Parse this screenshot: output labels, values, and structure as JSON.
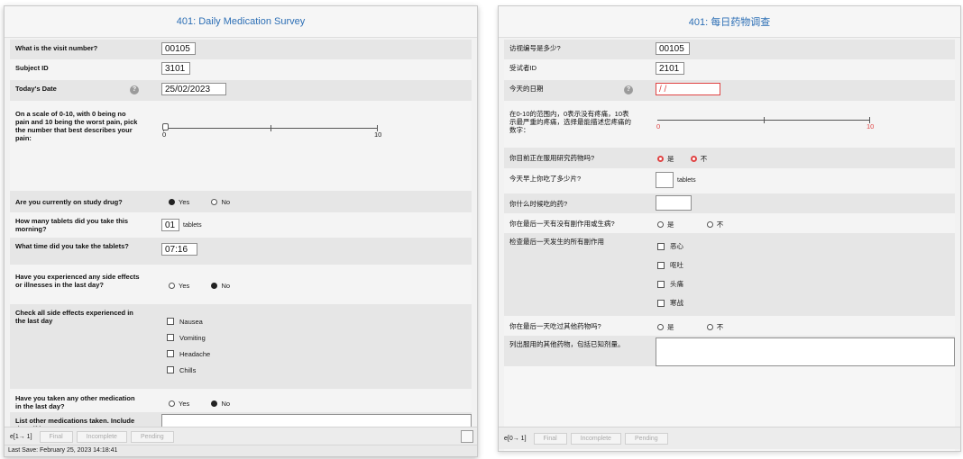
{
  "left": {
    "title": "401: Daily Medication Survey",
    "visit_q": "What is the visit number?",
    "visit_val": "00105",
    "subject_q": "Subject ID",
    "subject_val": "3101",
    "date_q": "Today's Date",
    "date_val": "25/02/2023",
    "help_glyph": "?",
    "pain_q": "On a scale of 0-10, with 0 being no pain and 10 being the worst pain, pick the number that best describes your pain:",
    "pain_min": "0",
    "pain_max": "10",
    "pain_value": 0,
    "drug_q": "Are you currently on study drug?",
    "drug_yes": "Yes",
    "drug_no": "No",
    "tablets_q": "How many tablets did you take this morning?",
    "tablets_val": "01",
    "tablets_unit": "tablets",
    "time_q": "What time did you take the tablets?",
    "time_val": "07:16",
    "side_q": "Have you experienced any side effects or illnesses in the last day?",
    "side_yes": "Yes",
    "side_no": "No",
    "check_q": "Check all side effects experienced in the last day",
    "effects": [
      "Nausea",
      "Vomiting",
      "Headache",
      "Chills"
    ],
    "other_q": "Have you taken any other medication in the last day?",
    "other_yes": "Yes",
    "other_no": "No",
    "list_q": "List other medications taken. Include dose if known.",
    "footer": {
      "tab": "e[1→ 1]",
      "final": "Final",
      "incomplete": "Incomplete",
      "pending": "Pending"
    },
    "status": "Last Save: February 25, 2023 14:18:41"
  },
  "right": {
    "title": "401: 每日药物调查",
    "visit_q": "访视编号是多少?",
    "visit_val": "00105",
    "subject_q": "受试者ID",
    "subject_val": "2101",
    "date_q": "今天的日期",
    "date_val": "/ /",
    "help_glyph": "?",
    "pain_q": "在0-10的范围内，0表示没有疼痛，10表示最严重的疼痛，选择最能描述您疼痛的数字：",
    "pain_min": "0",
    "pain_max": "10",
    "drug_q": "你目前正在服用研究药物吗?",
    "drug_yes": "是",
    "drug_no": "不",
    "tablets_q": "今天早上你吃了多少片?",
    "tablets_unit": "tablets",
    "time_q": "你什么时候吃的药?",
    "side_q": "你在最后一天有没有副作用或生病?",
    "side_yes": "是",
    "side_no": "不",
    "check_q": "检查最后一天发生的所有副作用",
    "effects": [
      "恶心",
      "呕吐",
      "头痛",
      "寒战"
    ],
    "other_q": "你在最后一天吃过其他药物吗?",
    "other_yes": "是",
    "other_no": "不",
    "list_q": "列出服用的其他药物，包括已知剂量。",
    "footer": {
      "tab": "e[0→ 1]",
      "final": "Final",
      "incomplete": "Incomplete",
      "pending": "Pending"
    }
  }
}
